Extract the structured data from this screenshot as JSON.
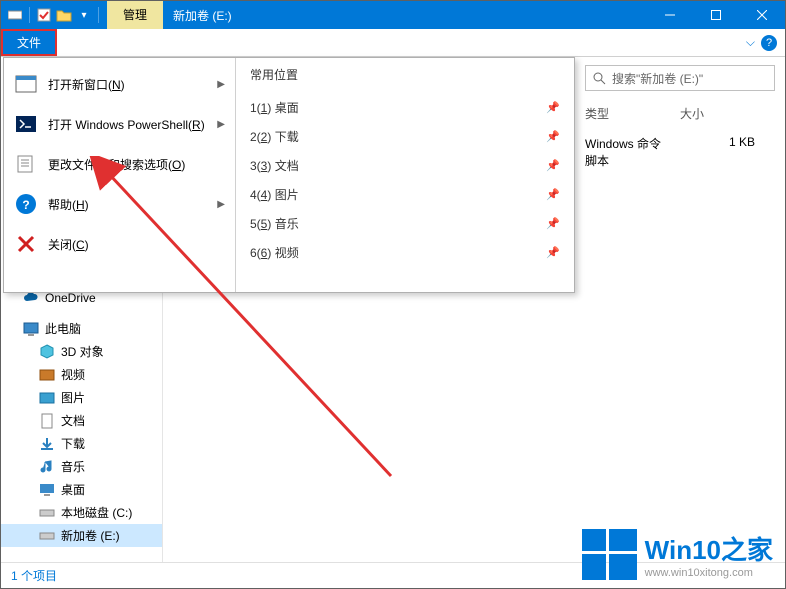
{
  "titlebar": {
    "manage": "管理",
    "volume": "新加卷 (E:)"
  },
  "fileribbon": {
    "file": "文件"
  },
  "search": {
    "placeholder": "搜索\"新加卷 (E:)\""
  },
  "columns": {
    "type": "类型",
    "size": "大小"
  },
  "filerow": {
    "type": "Windows 命令脚本",
    "size": "1 KB"
  },
  "statusbar": {
    "count": "1 个项目"
  },
  "nav": {
    "onedrive": "OneDrive",
    "thispc": "此电脑",
    "obj3d": "3D 对象",
    "video": "视频",
    "pic": "图片",
    "doc": "文档",
    "download": "下载",
    "music": "音乐",
    "desktop": "桌面",
    "cdisk": "本地磁盘 (C:)",
    "edisk": "新加卷 (E:)"
  },
  "filemenu": {
    "newwin": {
      "pre": "打开新窗口(",
      "mn": "N",
      "post": ")"
    },
    "ps": {
      "pre": "打开 Windows PowerShell(",
      "mn": "R",
      "post": ")"
    },
    "opts": {
      "pre": "更改文件夹和搜索选项(",
      "mn": "O",
      "post": ")"
    },
    "help": {
      "pre": "帮助(",
      "mn": "H",
      "post": ")"
    },
    "close": {
      "pre": "关闭(",
      "mn": "C",
      "post": ")"
    },
    "header": "常用位置",
    "loc": [
      {
        "n": "1",
        "mn": "1",
        "t": "桌面"
      },
      {
        "n": "2",
        "mn": "2",
        "t": "下载"
      },
      {
        "n": "3",
        "mn": "3",
        "t": "文档"
      },
      {
        "n": "4",
        "mn": "4",
        "t": "图片"
      },
      {
        "n": "5",
        "mn": "5",
        "t": "音乐"
      },
      {
        "n": "6",
        "mn": "6",
        "t": "视频"
      }
    ]
  },
  "watermark": {
    "big": "Win10之家",
    "small": "www.win10xitong.com"
  }
}
